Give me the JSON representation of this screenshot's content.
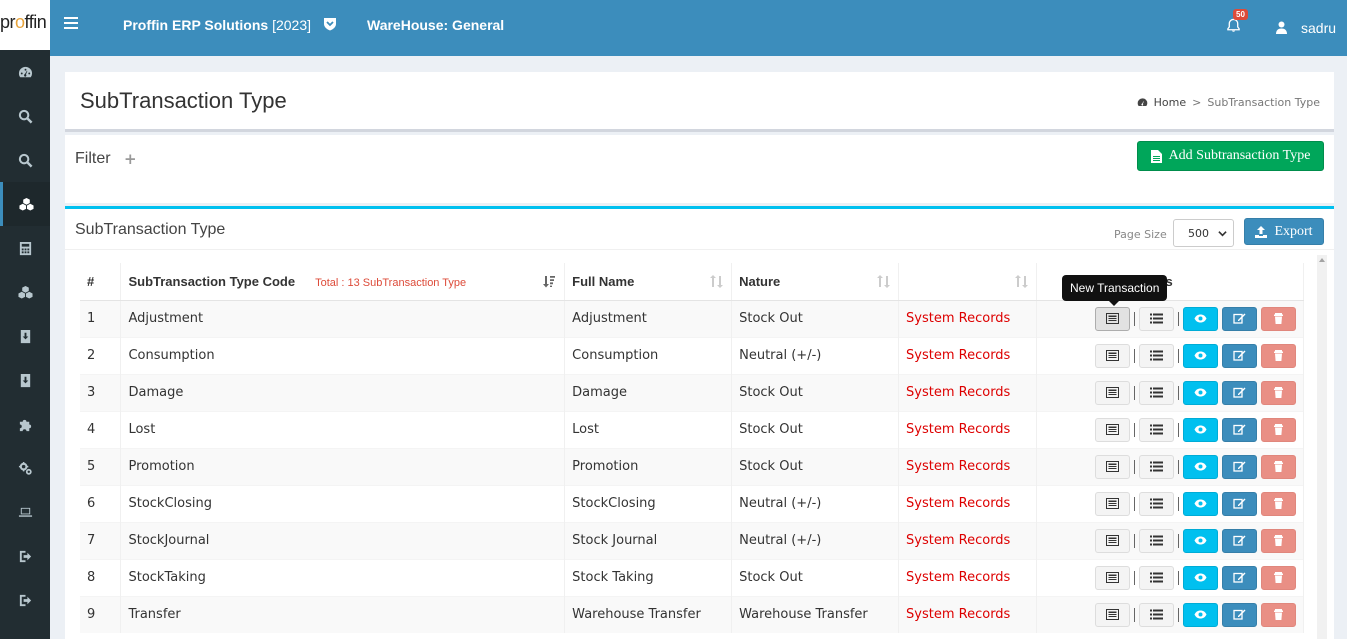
{
  "header": {
    "logo": "proffin",
    "app_title": "Proffin ERP Solutions",
    "app_year": "[2023]",
    "warehouse": "WareHouse: General",
    "notification_count": "50",
    "username": "sadru"
  },
  "sidebar": {
    "items": [
      {
        "icon": "dashboard-icon"
      },
      {
        "icon": "search-icon"
      },
      {
        "icon": "search-icon"
      },
      {
        "icon": "cubes-icon",
        "active": true
      },
      {
        "icon": "calculator-icon"
      },
      {
        "icon": "cubes-icon"
      },
      {
        "icon": "download-icon"
      },
      {
        "icon": "download-icon"
      },
      {
        "icon": "puzzle-icon"
      },
      {
        "icon": "cogs-icon"
      },
      {
        "icon": "laptop-icon"
      },
      {
        "icon": "sign-out-icon"
      },
      {
        "icon": "sign-out-icon"
      }
    ]
  },
  "page": {
    "title": "SubTransaction Type",
    "breadcrumb": {
      "home": "Home",
      "current": "SubTransaction Type"
    }
  },
  "filter": {
    "title": "Filter",
    "plus": "+",
    "add_button": "Add Subtransaction Type"
  },
  "table_box": {
    "title": "SubTransaction Type",
    "page_size_label": "Page Size",
    "page_size_value": "500",
    "export_label": "Export",
    "tooltip": "New Transaction"
  },
  "table": {
    "headers": {
      "num": "#",
      "code": "SubTransaction Type Code",
      "total": "Total : 13 SubTransaction Type",
      "full_name": "Full Name",
      "nature": "Nature",
      "extra": "",
      "tools": "ols"
    },
    "rows": [
      {
        "num": "1",
        "code": "Adjustment",
        "full_name": "Adjustment",
        "nature": "Stock Out",
        "type": "System Records"
      },
      {
        "num": "2",
        "code": "Consumption",
        "full_name": "Consumption",
        "nature": "Neutral (+/-)",
        "type": "System Records"
      },
      {
        "num": "3",
        "code": "Damage",
        "full_name": "Damage",
        "nature": "Stock Out",
        "type": "System Records"
      },
      {
        "num": "4",
        "code": "Lost",
        "full_name": "Lost",
        "nature": "Stock Out",
        "type": "System Records"
      },
      {
        "num": "5",
        "code": "Promotion",
        "full_name": "Promotion",
        "nature": "Stock Out",
        "type": "System Records"
      },
      {
        "num": "6",
        "code": "StockClosing",
        "full_name": "StockClosing",
        "nature": "Neutral (+/-)",
        "type": "System Records"
      },
      {
        "num": "7",
        "code": "StockJournal",
        "full_name": "Stock Journal",
        "nature": "Neutral (+/-)",
        "type": "System Records"
      },
      {
        "num": "8",
        "code": "StockTaking",
        "full_name": "Stock Taking",
        "nature": "Stock Out",
        "type": "System Records"
      },
      {
        "num": "9",
        "code": "Transfer",
        "full_name": "Warehouse Transfer",
        "nature": "Warehouse Transfer",
        "type": "System Records"
      }
    ]
  },
  "colors": {
    "header_bg": "#3c8dbc",
    "sidebar_bg": "#222d32",
    "add_button": "#00a65a",
    "view_button": "#00c0ef",
    "edit_button": "#3c8dbc",
    "delete_button": "#e98f85",
    "system_records_text": "#dd0000"
  }
}
